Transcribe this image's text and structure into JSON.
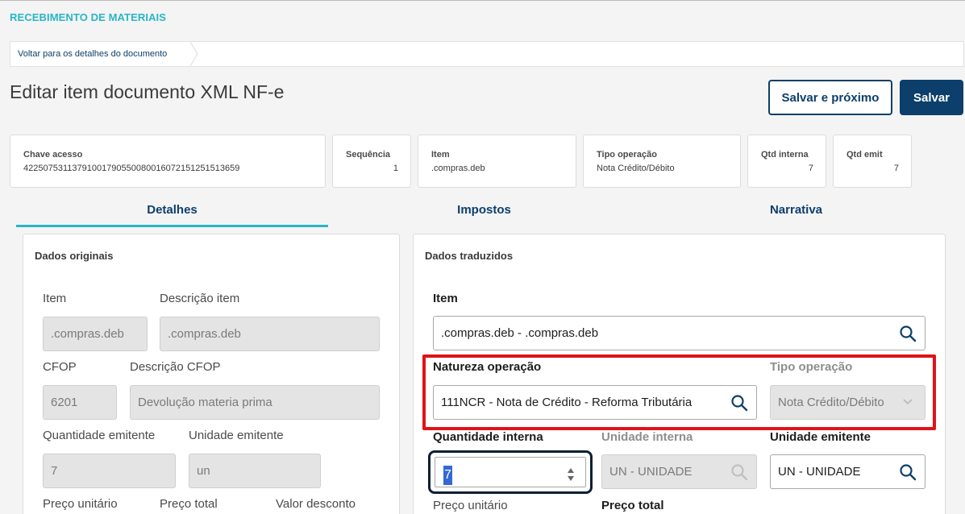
{
  "header": {
    "module_title": "RECEBIMENTO DE MATERIAIS",
    "breadcrumb": "Voltar para os detalhes do documento",
    "page_title": "Editar item documento XML NF-e",
    "save_next_label": "Salvar e próximo",
    "save_label": "Salvar"
  },
  "summary": [
    {
      "label": "Chave acesso",
      "value": "42250753113791001790550080016072151251513659"
    },
    {
      "label": "Sequência",
      "value": "1"
    },
    {
      "label": "Item",
      "value": ".compras.deb"
    },
    {
      "label": "Tipo operação",
      "value": "Nota Crédito/Débito"
    },
    {
      "label": "Qtd interna",
      "value": "7"
    },
    {
      "label": "Qtd emit",
      "value": "7"
    }
  ],
  "tabs": [
    "Detalhes",
    "Impostos",
    "Narrativa"
  ],
  "active_tab": "Detalhes",
  "original": {
    "title": "Dados originais",
    "item_label": "Item",
    "item_value": ".compras.deb",
    "desc_item_label": "Descrição item",
    "desc_item_value": ".compras.deb",
    "cfop_label": "CFOP",
    "cfop_value": "6201",
    "desc_cfop_label": "Descrição CFOP",
    "desc_cfop_value": "Devolução materia prima",
    "qty_label": "Quantidade emitente",
    "qty_value": "7",
    "unit_label": "Unidade emitente",
    "unit_value": "un",
    "unit_price_label": "Preço unitário",
    "total_price_label": "Preço total",
    "discount_label": "Valor desconto"
  },
  "translated": {
    "title": "Dados traduzidos",
    "item_label": "Item",
    "item_value": ".compras.deb - .compras.deb",
    "nature_label": "Natureza operação",
    "nature_value": "111NCR - Nota de Crédito - Reforma Tributária",
    "op_type_label": "Tipo operação",
    "op_type_value": "Nota Crédito/Débito",
    "internal_qty_label": "Quantidade interna",
    "internal_qty_value": "7",
    "internal_unit_label": "Unidade interna",
    "internal_unit_value": "UN - UNIDADE",
    "emit_unit_label": "Unidade emitente",
    "emit_unit_value": "UN - UNIDADE",
    "unit_price_label": "Preço unitário",
    "total_price_label": "Preço total"
  },
  "colors": {
    "accent": "#29b6c5",
    "primary": "#0c3f6b",
    "highlight": "#e0131a"
  }
}
